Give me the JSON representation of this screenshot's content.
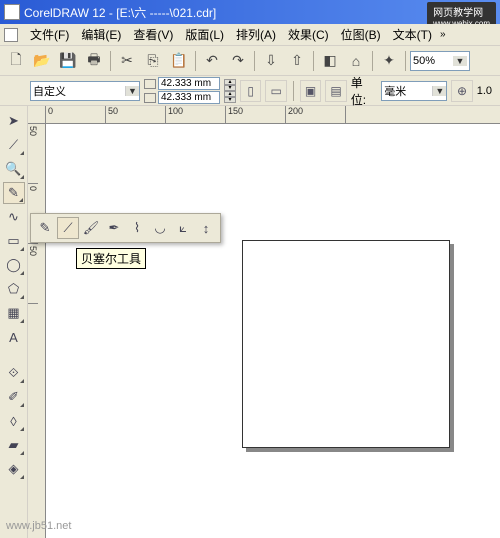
{
  "title": "CorelDRAW 12 - [E:\\六  -----\\021.cdr]",
  "watermark_tr": "网页教学网",
  "watermark_tr_sub": "www.webjx.com",
  "watermark_bl": "www.jb51.net",
  "menu": {
    "file": "文件(F)",
    "edit": "编辑(E)",
    "view": "查看(V)",
    "layout": "版面(L)",
    "arrange": "排列(A)",
    "effects": "效果(C)",
    "bitmap": "位图(B)",
    "text": "文本(T)"
  },
  "toolbar": {
    "zoom": "50%"
  },
  "propbar": {
    "paper": "自定义",
    "width": "42.333 mm",
    "height": "42.333 mm",
    "unit_label": "单位:",
    "unit": "毫米",
    "nudge": "1.0"
  },
  "ruler_h": [
    "0",
    "50",
    "100",
    "150",
    "200"
  ],
  "ruler_v": [
    "50",
    "0",
    "50"
  ],
  "tooltip": "贝塞尔工具"
}
